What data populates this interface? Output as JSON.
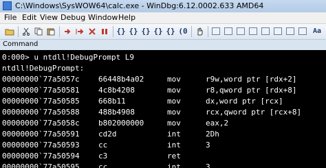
{
  "window": {
    "title": "C:\\Windows\\SysWOW64\\calc.exe - WinDbg:6.12.0002.633 AMD64"
  },
  "menu": {
    "items": [
      "File",
      "Edit",
      "View",
      "Debug",
      "Window",
      "Help"
    ]
  },
  "toolbar": {
    "buttons": [
      "open-icon",
      "cut-icon",
      "copy-icon",
      "paste-icon",
      "go-icon",
      "restart-icon",
      "stop-icon",
      "break-icon",
      "step-into-icon",
      "step-over-icon",
      "step-out-icon",
      "run-to-cursor-icon",
      "source-mode-icon",
      "command-window-icon",
      "watch-window-icon",
      "locals-window-icon",
      "registers-window-icon",
      "memory-window-icon",
      "call-stack-window-icon",
      "disassembly-window-icon",
      "scratch-pad-icon",
      "font-icon"
    ],
    "glyphs": [
      "(0",
      "{}",
      "{}",
      "{}",
      "{}",
      "{}",
      "Aa"
    ]
  },
  "panel": {
    "title": "Command"
  },
  "console": {
    "prompt_line": "0:000> u ntdll!DebugPrompt L9",
    "symbol_line": "ntdll!DebugPrompt:",
    "rows": [
      {
        "addr": "00000000`77a5057c",
        "bytes": "66448b4a02",
        "op": "mov",
        "args": "r9w,word ptr [rdx+2]"
      },
      {
        "addr": "00000000`77a50581",
        "bytes": "4c8b4208",
        "op": "mov",
        "args": "r8,qword ptr [rdx+8]"
      },
      {
        "addr": "00000000`77a50585",
        "bytes": "668b11",
        "op": "mov",
        "args": "dx,word ptr [rcx]"
      },
      {
        "addr": "00000000`77a50588",
        "bytes": "488b4908",
        "op": "mov",
        "args": "rcx,qword ptr [rcx+8]"
      },
      {
        "addr": "00000000`77a5058c",
        "bytes": "b802000000",
        "op": "mov",
        "args": "eax,2"
      },
      {
        "addr": "00000000`77a50591",
        "bytes": "cd2d",
        "op": "int",
        "args": "2Dh"
      },
      {
        "addr": "00000000`77a50593",
        "bytes": "cc",
        "op": "int",
        "args": "3"
      },
      {
        "addr": "00000000`77a50594",
        "bytes": "c3",
        "op": "ret",
        "args": ""
      },
      {
        "addr": "00000000`77a50595",
        "bytes": "cc",
        "op": "int",
        "args": "3"
      }
    ]
  },
  "colors": {
    "console_background": "#000000",
    "console_text": "#ffffff"
  }
}
